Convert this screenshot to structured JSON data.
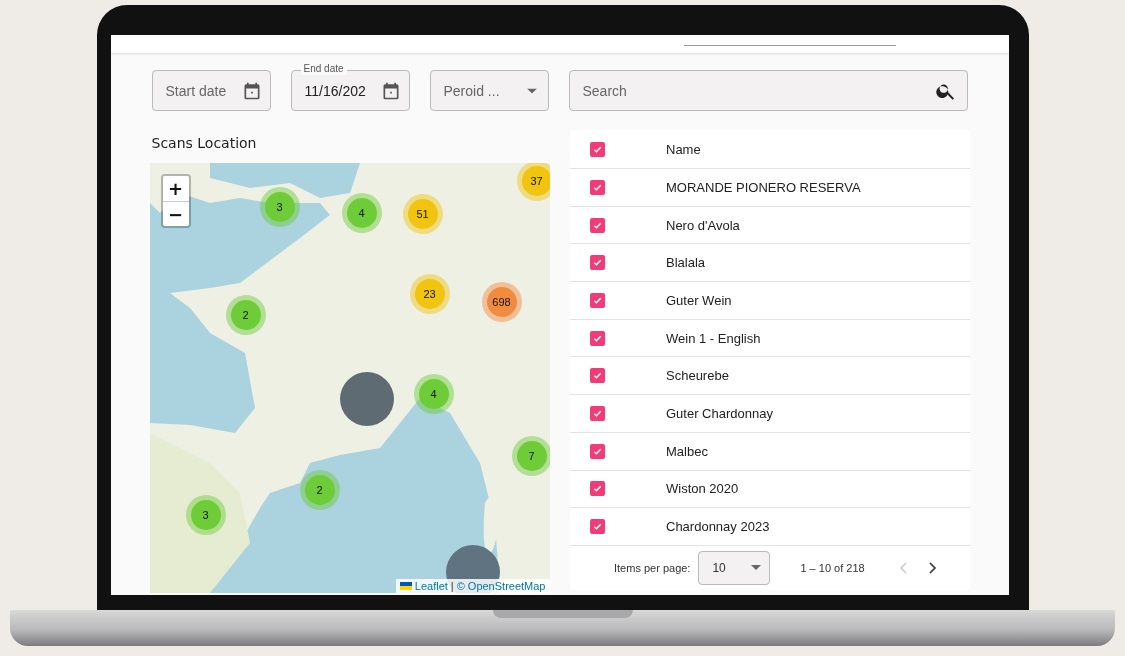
{
  "filters": {
    "start_date": {
      "placeholder": "Start date"
    },
    "end_date": {
      "label": "End date",
      "value": "11/16/202"
    },
    "period": {
      "placeholder": "Peroid ..."
    },
    "search": {
      "placeholder": "Search"
    }
  },
  "map": {
    "title": "Scans Location",
    "zoom_in": "+",
    "zoom_out": "−",
    "clusters": [
      {
        "kind": "count",
        "count": "37",
        "color": "#f1c40f"
      },
      {
        "kind": "count",
        "count": "3",
        "color": "#6ecc39"
      },
      {
        "kind": "count",
        "count": "4",
        "color": "#6ecc39"
      },
      {
        "kind": "count",
        "count": "51",
        "color": "#f1c40f"
      },
      {
        "kind": "count",
        "count": "23",
        "color": "#f1c40f"
      },
      {
        "kind": "count",
        "count": "698",
        "color": "#f08b40"
      },
      {
        "kind": "count",
        "count": "2",
        "color": "#6ecc39"
      },
      {
        "kind": "blank",
        "color": "#5f6b73"
      },
      {
        "kind": "count",
        "count": "4",
        "color": "#6ecc39"
      },
      {
        "kind": "count",
        "count": "7",
        "color": "#6ecc39"
      },
      {
        "kind": "count",
        "count": "2",
        "color": "#6ecc39"
      },
      {
        "kind": "count",
        "count": "3",
        "color": "#6ecc39"
      },
      {
        "kind": "blank",
        "color": "#5f7480"
      }
    ],
    "attribution": {
      "leaflet": "Leaflet",
      "separator": "|",
      "osm": "© OpenStreetMap"
    }
  },
  "table": {
    "header": {
      "checked": true,
      "label": "Name"
    },
    "rows": [
      {
        "checked": true,
        "name": "MORANDE PIONERO RESERVA"
      },
      {
        "checked": true,
        "name": "Nero d'Avola"
      },
      {
        "checked": true,
        "name": "Blalala"
      },
      {
        "checked": true,
        "name": "Guter Wein"
      },
      {
        "checked": true,
        "name": "Wein 1 - English"
      },
      {
        "checked": true,
        "name": "Scheurebe"
      },
      {
        "checked": true,
        "name": "Guter Chardonnay"
      },
      {
        "checked": true,
        "name": "Malbec"
      },
      {
        "checked": true,
        "name": "Wiston 2020"
      },
      {
        "checked": true,
        "name": "Chardonnay 2023"
      }
    ]
  },
  "paginator": {
    "label": "Items per page:",
    "page_size": "10",
    "range": "1 – 10 of 218",
    "prev": {
      "disabled": true
    },
    "next": {
      "disabled": false
    }
  }
}
